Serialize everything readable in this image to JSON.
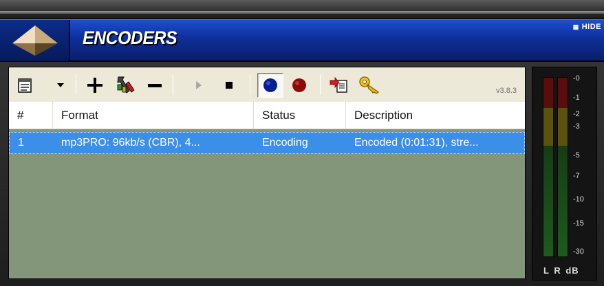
{
  "header": {
    "title": "ENCODERS",
    "hide_label": "HIDE",
    "accent": "#0e2f99"
  },
  "toolbar": {
    "version": "v3.8.3",
    "buttons": [
      "list-icon",
      "dropdown-arrow",
      "add",
      "configure",
      "remove",
      "play",
      "stop",
      "record-blue",
      "record-red",
      "import",
      "key"
    ]
  },
  "list": {
    "columns": [
      "#",
      "Format",
      "Status",
      "Description"
    ],
    "rows": [
      {
        "num": "1",
        "format": "mp3PRO: 96kb/s (CBR), 4...",
        "status": "Encoding",
        "description": "Encoded (0:01:31), stre..."
      }
    ],
    "selected_color": "#3b8fe8",
    "background": "#84967a"
  },
  "meter": {
    "scale": [
      "-0",
      "-1",
      "-2",
      "-3",
      "-5",
      "-7",
      "-10",
      "-15",
      "-30"
    ],
    "footer": "L R dB"
  }
}
